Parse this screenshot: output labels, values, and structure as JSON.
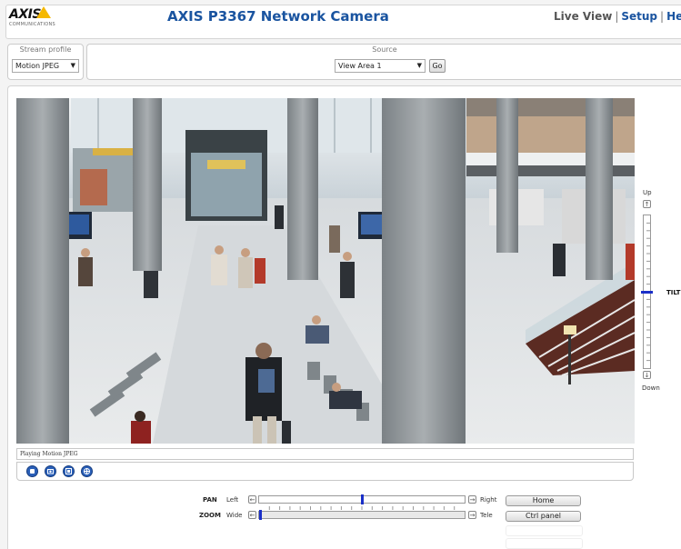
{
  "header": {
    "logo_text": "AXIS",
    "logo_tagline": "COMMUNICATIONS",
    "title": "AXIS P3367 Network Camera",
    "nav": {
      "live_view": "Live View",
      "separator": "|",
      "setup": "Setup",
      "help": "Help"
    }
  },
  "stream_profile": {
    "label": "Stream profile",
    "value": "Motion JPEG"
  },
  "source": {
    "label": "Source",
    "value": "View Area 1",
    "go_label": "Go"
  },
  "video": {
    "status_text": "Playing Motion JPEG"
  },
  "controls": {
    "buttons": [
      "stop-icon",
      "snapshot-icon",
      "fullscreen-icon",
      "ptz-icon"
    ]
  },
  "tilt": {
    "up_label": "Up",
    "down_label": "Down",
    "label": "TILT",
    "position": 0.5
  },
  "pan": {
    "label": "PAN",
    "left_label": "Left",
    "right_label": "Right",
    "position": 0.5
  },
  "zoom": {
    "label": "ZOOM",
    "wide_label": "Wide",
    "tele_label": "Tele",
    "position": 0.0
  },
  "buttons": {
    "home_label": "Home",
    "ctrl_panel_label": "Ctrl panel"
  },
  "colors": {
    "brand_blue": "#1a54a0",
    "logo_yellow": "#f5b800",
    "slider_thumb": "#1a2fc8"
  }
}
